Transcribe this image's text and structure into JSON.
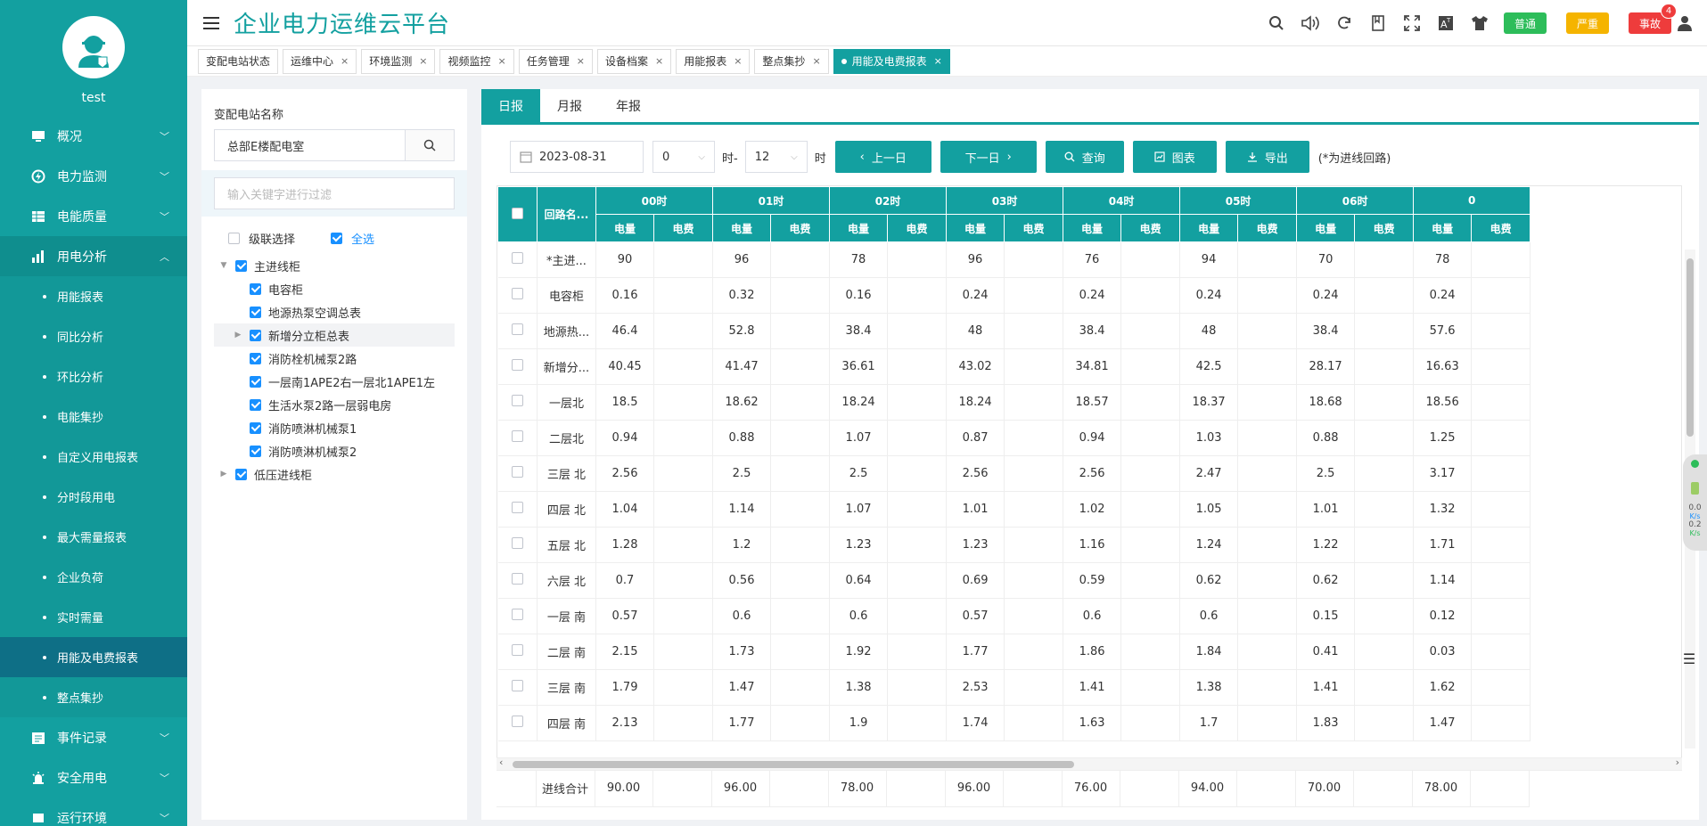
{
  "app": {
    "title": "企业电力运维云平台",
    "username": "test"
  },
  "sidebar": {
    "menus": [
      {
        "label": "概况",
        "icon": "monitor-icon"
      },
      {
        "label": "电力监测",
        "icon": "power-icon"
      },
      {
        "label": "电能质量",
        "icon": "grid-icon"
      },
      {
        "label": "用电分析",
        "icon": "bar-chart-icon",
        "open": true
      }
    ],
    "sub_items": [
      {
        "label": "用能报表"
      },
      {
        "label": "同比分析"
      },
      {
        "label": "环比分析"
      },
      {
        "label": "电能集抄"
      },
      {
        "label": "自定义用电报表"
      },
      {
        "label": "分时段用电"
      },
      {
        "label": "最大需量报表"
      },
      {
        "label": "企业负荷"
      },
      {
        "label": "实时需量"
      },
      {
        "label": "用能及电费报表",
        "active": true
      },
      {
        "label": "整点集抄"
      }
    ],
    "bottom_menus": [
      {
        "label": "事件记录",
        "icon": "calendar-icon"
      },
      {
        "label": "安全用电",
        "icon": "alarm-icon"
      },
      {
        "label": "运行环境",
        "icon": "environment-icon"
      }
    ]
  },
  "topbar": {
    "level_normal": "普通",
    "level_serious": "严重",
    "level_accident": "事故",
    "notif_count": "4"
  },
  "tabs": [
    {
      "label": "变配电站状态",
      "closable": false
    },
    {
      "label": "运维中心",
      "closable": true
    },
    {
      "label": "环境监测",
      "closable": true
    },
    {
      "label": "视频监控",
      "closable": true
    },
    {
      "label": "任务管理",
      "closable": true
    },
    {
      "label": "设备档案",
      "closable": true
    },
    {
      "label": "用能报表",
      "closable": true
    },
    {
      "label": "整点集抄",
      "closable": true
    },
    {
      "label": "用能及电费报表",
      "closable": true,
      "active": true
    }
  ],
  "left": {
    "station_label": "变配电站名称",
    "station_value": "总部E楼配电室",
    "filter_placeholder": "输入关键字进行过滤",
    "cascade_label": "级联选择",
    "select_all_label": "全选",
    "tree": [
      {
        "label": "主进线柜",
        "level": 0,
        "caret": "▼"
      },
      {
        "label": "电容柜",
        "level": 1,
        "caret": ""
      },
      {
        "label": "地源热泵空调总表",
        "level": 1,
        "caret": ""
      },
      {
        "label": "新增分立柜总表",
        "level": 1,
        "caret": "▶",
        "hl": true
      },
      {
        "label": "消防栓机械泵2路",
        "level": 1,
        "caret": ""
      },
      {
        "label": "一层南1APE2右一层北1APE1左",
        "level": 1,
        "caret": ""
      },
      {
        "label": "生活水泵2路一层弱电房",
        "level": 1,
        "caret": ""
      },
      {
        "label": "消防喷淋机械泵1",
        "level": 1,
        "caret": ""
      },
      {
        "label": "消防喷淋机械泵2",
        "level": 1,
        "caret": ""
      },
      {
        "label": "低压进线柜",
        "level": 0,
        "caret": "▶"
      }
    ]
  },
  "main": {
    "subtabs": [
      {
        "label": "日报",
        "active": true
      },
      {
        "label": "月报"
      },
      {
        "label": "年报"
      }
    ],
    "date": "2023-08-31",
    "hour_from": "0",
    "hour_to": "12",
    "hour_sep": "时-",
    "hour_suffix": "时",
    "btn_prev": "上一日",
    "btn_next": "下一日",
    "btn_query": "查询",
    "btn_chart": "图表",
    "btn_export": "导出",
    "note": "(*为进线回路)",
    "col_name": "回路名...",
    "hours": [
      "00时",
      "01时",
      "02时",
      "03时",
      "04时",
      "05时",
      "06时",
      "0"
    ],
    "sub_kwh": "电量",
    "sub_fee": "电费",
    "rows": [
      {
        "name": "*主进...",
        "v": [
          "90",
          "96",
          "78",
          "96",
          "76",
          "94",
          "70",
          "78"
        ]
      },
      {
        "name": "电容柜",
        "v": [
          "0.16",
          "0.32",
          "0.16",
          "0.24",
          "0.24",
          "0.24",
          "0.24",
          "0.24"
        ]
      },
      {
        "name": "地源热...",
        "v": [
          "46.4",
          "52.8",
          "38.4",
          "48",
          "38.4",
          "48",
          "38.4",
          "57.6"
        ]
      },
      {
        "name": "新增分...",
        "v": [
          "40.45",
          "41.47",
          "36.61",
          "43.02",
          "34.81",
          "42.5",
          "28.17",
          "16.63"
        ]
      },
      {
        "name": "一层北",
        "v": [
          "18.5",
          "18.62",
          "18.24",
          "18.24",
          "18.57",
          "18.37",
          "18.68",
          "18.56"
        ]
      },
      {
        "name": "二层北",
        "v": [
          "0.94",
          "0.88",
          "1.07",
          "0.87",
          "0.94",
          "1.03",
          "0.88",
          "1.25"
        ]
      },
      {
        "name": "三层 北",
        "v": [
          "2.56",
          "2.5",
          "2.5",
          "2.56",
          "2.56",
          "2.47",
          "2.5",
          "3.17"
        ]
      },
      {
        "name": "四层 北",
        "v": [
          "1.04",
          "1.14",
          "1.07",
          "1.01",
          "1.02",
          "1.05",
          "1.01",
          "1.32"
        ]
      },
      {
        "name": "五层 北",
        "v": [
          "1.28",
          "1.2",
          "1.23",
          "1.23",
          "1.16",
          "1.24",
          "1.22",
          "1.71"
        ]
      },
      {
        "name": "六层 北",
        "v": [
          "0.7",
          "0.56",
          "0.64",
          "0.69",
          "0.59",
          "0.62",
          "0.62",
          "1.14"
        ]
      },
      {
        "name": "一层 南",
        "v": [
          "0.57",
          "0.6",
          "0.6",
          "0.57",
          "0.6",
          "0.6",
          "0.15",
          "0.12"
        ]
      },
      {
        "name": "二层 南",
        "v": [
          "2.15",
          "1.73",
          "1.92",
          "1.77",
          "1.86",
          "1.84",
          "0.41",
          "0.03"
        ]
      },
      {
        "name": "三层 南",
        "v": [
          "1.79",
          "1.47",
          "1.38",
          "2.53",
          "1.41",
          "1.38",
          "1.41",
          "1.62"
        ]
      },
      {
        "name": "四层 南",
        "v": [
          "2.13",
          "1.77",
          "1.9",
          "1.74",
          "1.63",
          "1.7",
          "1.83",
          "1.47"
        ]
      }
    ],
    "total_label": "进线合计",
    "totals": [
      "90.00",
      "96.00",
      "78.00",
      "96.00",
      "76.00",
      "94.00",
      "70.00",
      "78.00"
    ]
  },
  "widget": {
    "up": "0.0",
    "up_unit": "K/s",
    "down": "0.2",
    "down_unit": "K/s"
  }
}
